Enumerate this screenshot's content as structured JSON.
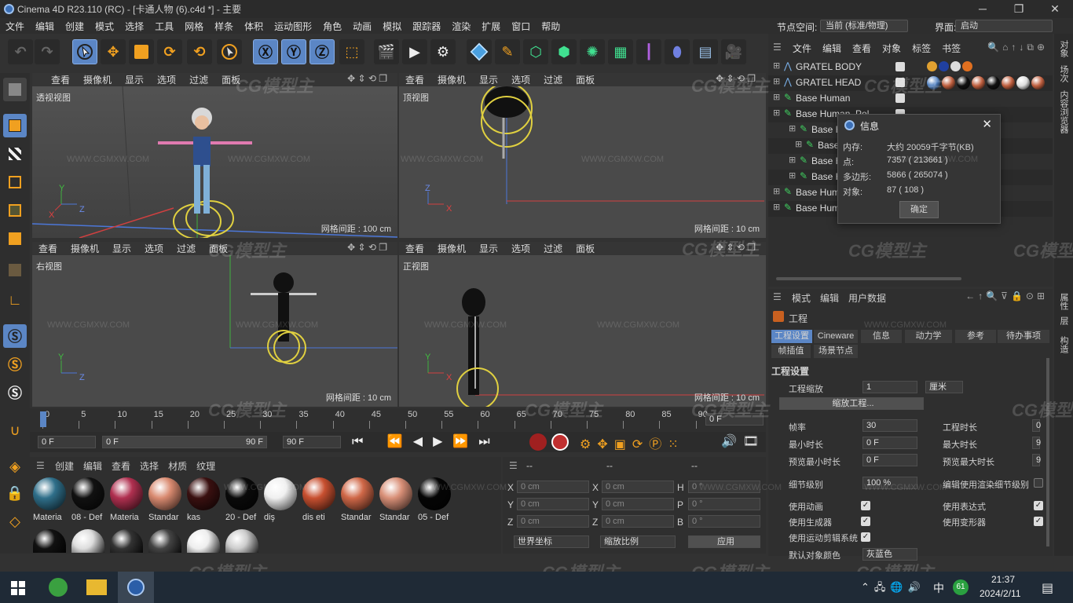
{
  "window": {
    "title": "Cinema 4D R23.110 (RC) - [卡通人物 (6).c4d *] - 主要",
    "min": "─",
    "max": "❐",
    "close": "✕"
  },
  "menu": [
    "文件",
    "编辑",
    "创建",
    "模式",
    "选择",
    "工具",
    "网格",
    "样条",
    "体积",
    "运动图形",
    "角色",
    "动画",
    "模拟",
    "跟踪器",
    "渲染",
    "扩展",
    "窗口",
    "帮助"
  ],
  "node_space": {
    "label": "节点空间:",
    "value": "当前 (标准/物理)"
  },
  "layout": {
    "label": "界面:",
    "value": "启动"
  },
  "viewports": [
    {
      "menu": [
        "查看",
        "摄像机",
        "显示",
        "选项",
        "过滤",
        "面板"
      ],
      "name": "透视视图",
      "grid": "网格间距 : 100 cm"
    },
    {
      "menu": [
        "查看",
        "摄像机",
        "显示",
        "选项",
        "过滤",
        "面板"
      ],
      "name": "顶视图",
      "grid": "网格间距 : 10 cm"
    },
    {
      "menu": [
        "查看",
        "摄像机",
        "显示",
        "选项",
        "过滤",
        "面板"
      ],
      "name": "右视图",
      "grid": "网格间距 : 10 cm"
    },
    {
      "menu": [
        "查看",
        "摄像机",
        "显示",
        "选项",
        "过滤",
        "面板"
      ],
      "name": "正视图",
      "grid": "网格间距 : 10 cm"
    }
  ],
  "axes": {
    "x": "X",
    "y": "Y",
    "z": "Z"
  },
  "timeline": {
    "ticks": [
      "0",
      "5",
      "10",
      "15",
      "20",
      "25",
      "30",
      "35",
      "40",
      "45",
      "50",
      "55",
      "60",
      "65",
      "70",
      "75",
      "80",
      "85",
      "90"
    ],
    "end": "0 F",
    "current": "0 F",
    "range_start": "0 F",
    "range_end": "90 F",
    "max": "90 F"
  },
  "materials": {
    "menu": [
      "创建",
      "编辑",
      "查看",
      "选择",
      "材质",
      "纹理"
    ],
    "items": [
      {
        "label": "Materia",
        "color": "#2f6f8a"
      },
      {
        "label": "08 - Def",
        "color": "#111111"
      },
      {
        "label": "Materia",
        "color": "#b03050"
      },
      {
        "label": "Standar",
        "color": "#d98a70"
      },
      {
        "label": "kas",
        "color": "#3a1010"
      },
      {
        "label": "20 - Def",
        "color": "#0a0a0a"
      },
      {
        "label": "diş",
        "color": "#f0f0f0"
      },
      {
        "label": "dis eti",
        "color": "#c85030"
      },
      {
        "label": "Standar",
        "color": "#d06848"
      },
      {
        "label": "Standar",
        "color": "#d99078"
      },
      {
        "label": "05 - Def",
        "color": "#050505"
      }
    ]
  },
  "coords": {
    "header": [
      "--",
      "--",
      "--"
    ],
    "rows": [
      {
        "a": "X",
        "av": "0 cm",
        "b": "X",
        "bv": "0 cm",
        "c": "H",
        "cv": "0 °"
      },
      {
        "a": "Y",
        "av": "0 cm",
        "b": "Y",
        "bv": "0 cm",
        "c": "P",
        "cv": "0 °"
      },
      {
        "a": "Z",
        "av": "0 cm",
        "b": "Z",
        "bv": "0 cm",
        "c": "B",
        "cv": "0 °"
      }
    ],
    "world": "世界坐标",
    "scale": "缩放比例",
    "apply": "应用"
  },
  "objects": {
    "menu": [
      "文件",
      "编辑",
      "查看",
      "对象",
      "标签",
      "书签"
    ],
    "rows": [
      "GRATEL BODY",
      "GRATEL HEAD",
      "Base Human",
      "Base Human_Pol...",
      "Base Hu",
      "Base I",
      "Base Hu",
      "Base Hu",
      "Base Hum",
      "Base Hum"
    ]
  },
  "dialog": {
    "title": "信息",
    "rows": [
      {
        "k": "内存:",
        "v": "大约 20059千字节(KB)"
      },
      {
        "k": "点:",
        "v": "7357 ( 213661 )"
      },
      {
        "k": "多边形:",
        "v": "5866 ( 265074 )"
      },
      {
        "k": "对象:",
        "v": "87 ( 108 )"
      }
    ],
    "ok": "确定"
  },
  "attributes": {
    "menu": [
      "模式",
      "编辑",
      "用户数据"
    ],
    "title": "工程",
    "tabs": [
      "工程设置",
      "Cineware",
      "信息",
      "动力学",
      "参考",
      "待办事项",
      "帧插值",
      "场景节点"
    ],
    "section": "工程设置",
    "scale_label": "工程缩放",
    "scale_value": "1",
    "scale_unit": "厘米",
    "scale_btn": "缩放工程...",
    "fps_label": "帧率",
    "fps": "30",
    "len_label": "工程时长",
    "len": "0",
    "min_label": "最小时长",
    "min": "0 F",
    "max_label": "最大时长",
    "max": "9",
    "pmin_label": "预览最小时长",
    "pmin": "0 F",
    "pmax_label": "预览最大时长",
    "pmax": "9",
    "lod_label": "细节级别",
    "lod": "100 %",
    "lodr_label": "编辑使用渲染细节级别",
    "checks": [
      "使用动画",
      "使用表达式",
      "使用生成器",
      "使用变形器",
      "使用运动剪辑系统"
    ],
    "default_color": "默认对象颜色",
    "default_color_value": "灰蓝色"
  },
  "right_tabs": [
    "对象",
    "场次",
    "内容浏览器",
    "属性",
    "层",
    "构造"
  ],
  "watermark": {
    "logo": "CG模型主",
    "url": "WWW.CGMXW.COM"
  },
  "taskbar": {
    "time": "21:37",
    "date": "2024/2/11",
    "ime": "中",
    "badge": "61"
  }
}
